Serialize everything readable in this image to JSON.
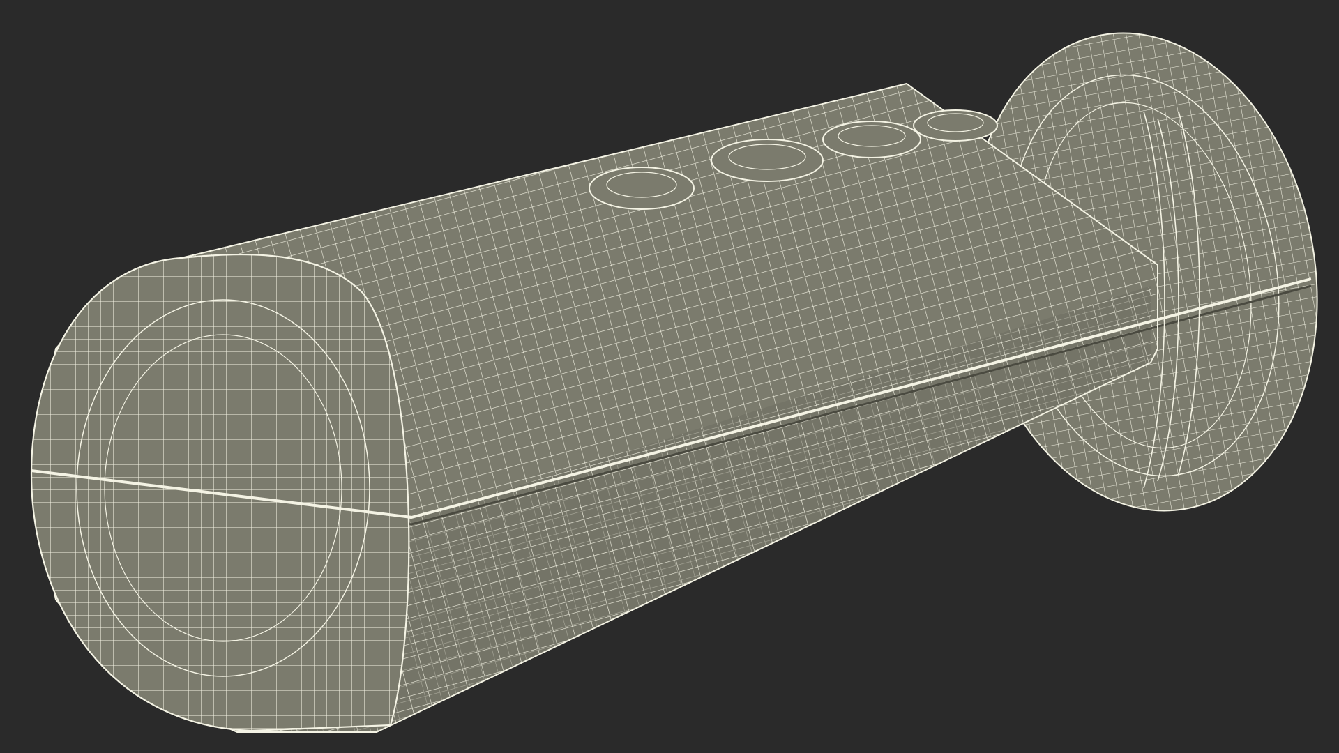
{
  "scene": {
    "subject": "wireframe-cylindrical-device",
    "colors": {
      "background": "#2a2a2a",
      "surface": "#7b7b6d",
      "surface_shadow": "#6a6a5e",
      "surface_dark": "#5a5a50",
      "wire": "#f4f3e4"
    }
  }
}
